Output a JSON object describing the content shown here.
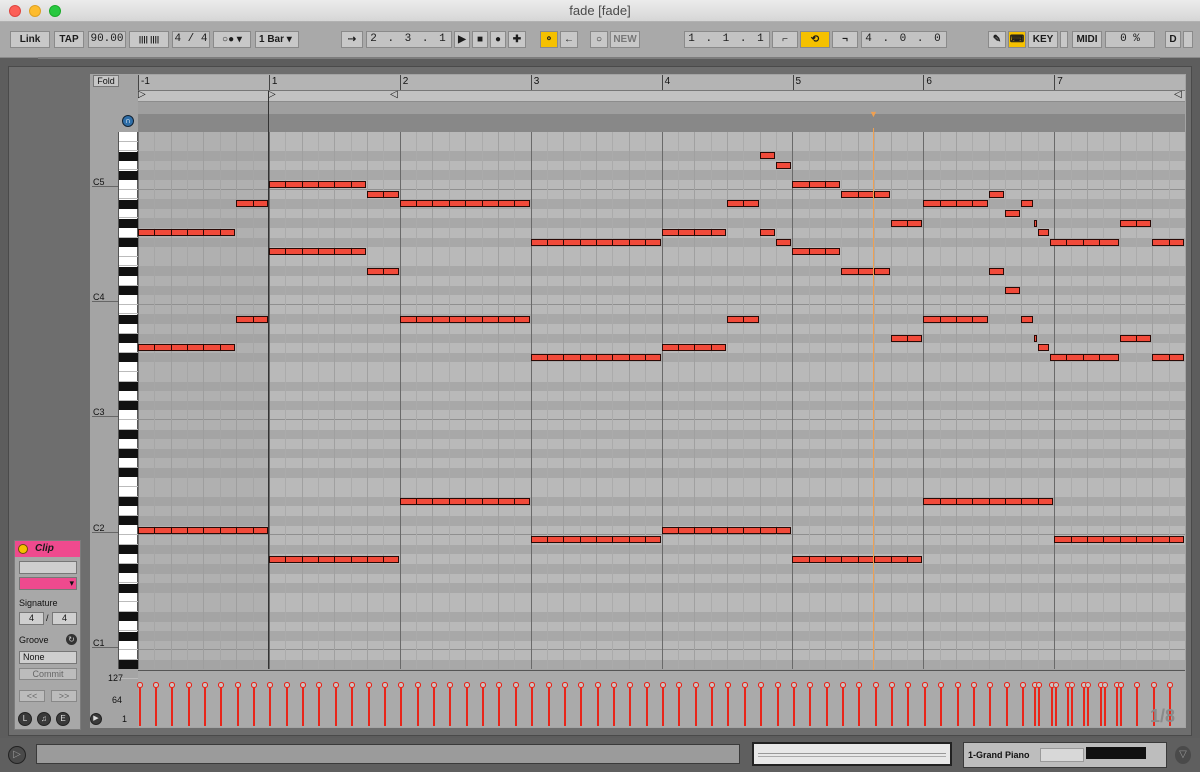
{
  "window": {
    "title": "fade [fade]"
  },
  "toolbar": {
    "link": "Link",
    "tap": "TAP",
    "tempo": "90.00",
    "metro_icon": "|||| ||||",
    "signature": "4 / 4",
    "quantize": "1 Bar",
    "arrangement_position": "2 .  3 .  1",
    "new_label": "NEW",
    "loop_start": "1 .  1 .  1",
    "loop_length": "4 .  0 .  0",
    "key_label": "KEY",
    "midi_label": "MIDI",
    "cpu": "0 %",
    "d_label": "D"
  },
  "clip_panel": {
    "header": "Clip",
    "signature_label": "Signature",
    "sig_num": "4",
    "sig_den": "4",
    "groove_label": "Groove",
    "groove_value": "None",
    "commit": "Commit",
    "prev": "<<",
    "next": ">>",
    "color": "#ef4a8e"
  },
  "editor": {
    "fold": "Fold",
    "bar_labels": [
      "-1",
      "1",
      "2",
      "3",
      "4",
      "5",
      "6",
      "7"
    ],
    "octave_labels": [
      "C5",
      "C4",
      "C3",
      "C2",
      "C1"
    ],
    "velocity_labels": [
      "127",
      "64",
      "1"
    ],
    "grid_quant": "1/8",
    "note_color": "#f14a3a",
    "velocity_color": "#e8261a",
    "playhead_color": "#f0a050"
  },
  "notes": [
    {
      "pitch": "G4",
      "start": 0,
      "len": 6
    },
    {
      "pitch": "G3",
      "start": 0,
      "len": 6
    },
    {
      "pitch": "C2",
      "start": 0,
      "len": 8
    },
    {
      "pitch": "A#4",
      "start": 6,
      "len": 2
    },
    {
      "pitch": "A#3",
      "start": 6,
      "len": 2
    },
    {
      "pitch": "C5",
      "start": 8,
      "len": 6
    },
    {
      "pitch": "F4",
      "start": 8,
      "len": 6
    },
    {
      "pitch": "A1",
      "start": 8,
      "len": 8
    },
    {
      "pitch": "B4",
      "start": 14,
      "len": 2
    },
    {
      "pitch": "D#4",
      "start": 14,
      "len": 2
    },
    {
      "pitch": "A#4",
      "start": 16,
      "len": 8
    },
    {
      "pitch": "A#3",
      "start": 16,
      "len": 8
    },
    {
      "pitch": "D#2",
      "start": 16,
      "len": 8
    },
    {
      "pitch": "F#4",
      "start": 24,
      "len": 8
    },
    {
      "pitch": "F#3",
      "start": 24,
      "len": 8
    },
    {
      "pitch": "B1",
      "start": 24,
      "len": 8
    },
    {
      "pitch": "G4",
      "start": 32,
      "len": 4
    },
    {
      "pitch": "G3",
      "start": 32,
      "len": 4
    },
    {
      "pitch": "C2",
      "start": 32,
      "len": 8
    },
    {
      "pitch": "A#4",
      "start": 36,
      "len": 2
    },
    {
      "pitch": "A#3",
      "start": 36,
      "len": 2
    },
    {
      "pitch": "D#5",
      "start": 38,
      "len": 1
    },
    {
      "pitch": "G4",
      "start": 38,
      "len": 1
    },
    {
      "pitch": "D5",
      "start": 39,
      "len": 1
    },
    {
      "pitch": "F#4",
      "start": 39,
      "len": 1
    },
    {
      "pitch": "C5",
      "start": 40,
      "len": 3
    },
    {
      "pitch": "F4",
      "start": 40,
      "len": 3
    },
    {
      "pitch": "A1",
      "start": 40,
      "len": 8
    },
    {
      "pitch": "B4",
      "start": 43,
      "len": 3
    },
    {
      "pitch": "D#4",
      "start": 43,
      "len": 3
    },
    {
      "pitch": "G#4",
      "start": 46,
      "len": 2
    },
    {
      "pitch": "G#3",
      "start": 46,
      "len": 2
    },
    {
      "pitch": "A#4",
      "start": 48,
      "len": 4
    },
    {
      "pitch": "A#3",
      "start": 48,
      "len": 4
    },
    {
      "pitch": "D#2",
      "start": 48,
      "len": 8
    },
    {
      "pitch": "B4",
      "start": 52,
      "len": 1
    },
    {
      "pitch": "D#4",
      "start": 52,
      "len": 1
    },
    {
      "pitch": "A4",
      "start": 53,
      "len": 1
    },
    {
      "pitch": "C#4",
      "start": 53,
      "len": 1
    },
    {
      "pitch": "A#4",
      "start": 54,
      "len": 0.75
    },
    {
      "pitch": "A#3",
      "start": 54,
      "len": 0.75
    },
    {
      "pitch": "G#4",
      "start": 54.75,
      "len": 0.25
    },
    {
      "pitch": "G#3",
      "start": 54.75,
      "len": 0.25
    },
    {
      "pitch": "G4",
      "start": 55,
      "len": 0.75
    },
    {
      "pitch": "G3",
      "start": 55,
      "len": 0.75
    },
    {
      "pitch": "F#4",
      "start": 55.75,
      "len": 4.25
    },
    {
      "pitch": "F#3",
      "start": 55.75,
      "len": 4.25
    },
    {
      "pitch": "B1",
      "start": 56,
      "len": 8
    },
    {
      "pitch": "G#4",
      "start": 60,
      "len": 2
    },
    {
      "pitch": "G#3",
      "start": 60,
      "len": 2
    },
    {
      "pitch": "F#4",
      "start": 62,
      "len": 2
    },
    {
      "pitch": "F#3",
      "start": 62,
      "len": 2
    }
  ],
  "bottom": {
    "track_name": "1-Grand Piano",
    "left_icons": [
      "L",
      "♫",
      "E"
    ]
  }
}
